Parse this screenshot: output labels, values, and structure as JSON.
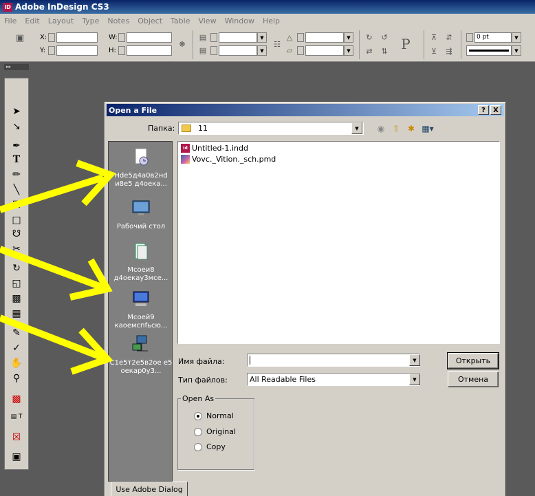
{
  "app": {
    "title": "Adobe InDesign CS3",
    "logo_text": "ID"
  },
  "menu": [
    "File",
    "Edit",
    "Layout",
    "Type",
    "Notes",
    "Object",
    "Table",
    "View",
    "Window",
    "Help"
  ],
  "control_panel": {
    "x_label": "X:",
    "y_label": "Y:",
    "w_label": "W:",
    "h_label": "H:",
    "stroke_value": "0 pt",
    "paragraph_glyph": "P"
  },
  "dialog": {
    "title": "Open a File",
    "help_button": "?",
    "close_button": "X",
    "look_in_label": "Папка:",
    "look_in_value": "11",
    "places": [
      {
        "label": "Hde5д4a0в2нd и8e5 д4oeка..."
      },
      {
        "label": "Рабочий стол"
      },
      {
        "label": "Mcoeи8 д4oeкау3мce..."
      },
      {
        "label": "Mcoeй9 каoeмcпfьcю..."
      },
      {
        "label": "C1e5т2e5в2oe e5 oeкар0у3..."
      }
    ],
    "files": [
      {
        "name": "Untitled-1.indd",
        "icon": "indesign-doc-icon"
      },
      {
        "name": "Vovc._Vition._sch.pmd",
        "icon": "pagemaker-doc-icon"
      }
    ],
    "file_name_label": "Имя файла:",
    "file_name_value": "",
    "file_type_label": "Тип файлов:",
    "file_type_value": "All Readable Files",
    "open_button": "Открыть",
    "cancel_button": "Отмена",
    "open_as": {
      "legend": "Open As",
      "options": [
        "Normal",
        "Original",
        "Copy"
      ],
      "selected": "Normal"
    },
    "adobe_dialog_button": "Use Adobe Dialog"
  },
  "colors": {
    "annotation_arrow": "#ffff00",
    "id_brand": "#b0164a"
  }
}
